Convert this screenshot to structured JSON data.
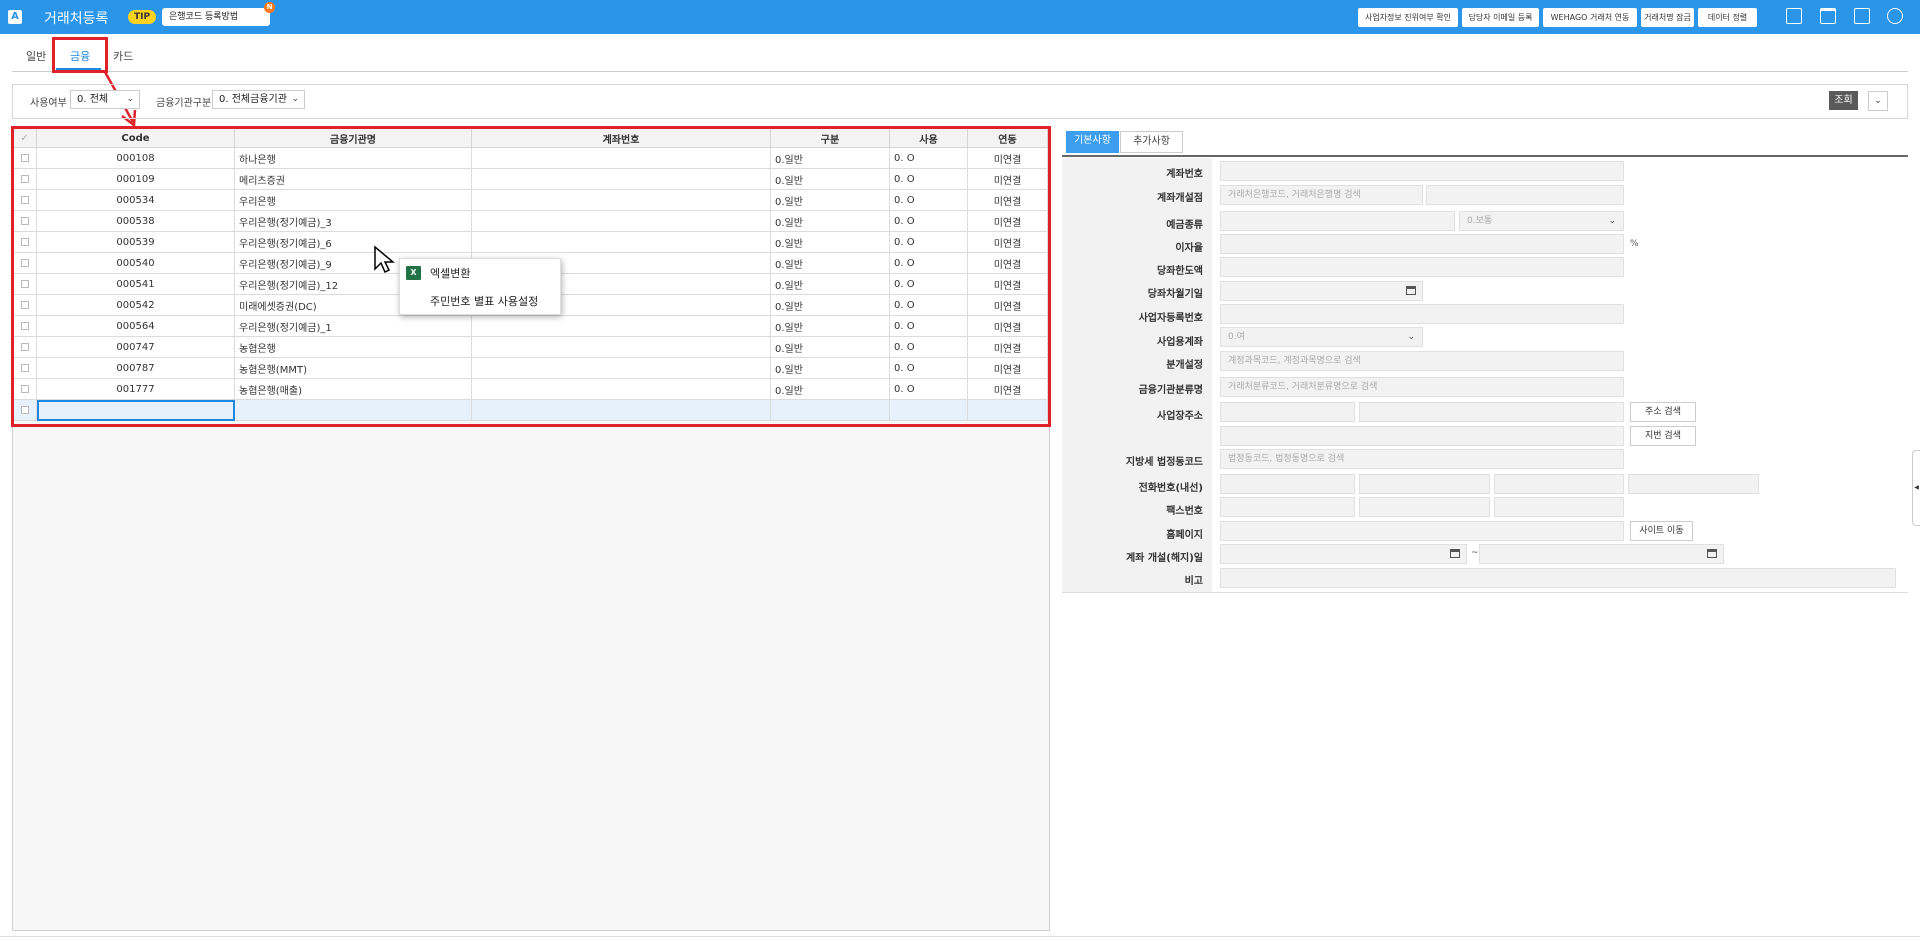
{
  "header": {
    "logo": "A",
    "title": "거래처등록",
    "tip_badge": "TIP",
    "tip_text": "은행코드 등록방법",
    "notification_badge": "N",
    "buttons": [
      "사업자정보 진위여부 확인",
      "담당자 이메일 등록",
      "WEHAGO 거래처 연동",
      "거래처명 잠금",
      "데이터 정렬"
    ],
    "icons": [
      "print-icon",
      "trash-icon",
      "form-icon",
      "settings-circle-icon"
    ],
    "color": "#2b95e9"
  },
  "tabs": [
    "일반",
    "금융",
    "카드"
  ],
  "active_tab": "금융",
  "filters": {
    "usage_label": "사용여부",
    "usage_value": "0. 전체",
    "institution_label": "금융기관구분",
    "institution_value": "0. 전체금융기관",
    "search_button": "조회"
  },
  "grid": {
    "columns": [
      "Code",
      "금융기관명",
      "계좌번호",
      "구분",
      "사용",
      "연동"
    ],
    "rows": [
      {
        "code": "000108",
        "name": "하나은행",
        "account": "",
        "type": "0.일반",
        "use": "0. O",
        "link": "미연결"
      },
      {
        "code": "000109",
        "name": "메리츠증권",
        "account": "",
        "type": "0.일반",
        "use": "0. O",
        "link": "미연결"
      },
      {
        "code": "000534",
        "name": "우리은행",
        "account": "",
        "type": "0.일반",
        "use": "0. O",
        "link": "미연결"
      },
      {
        "code": "000538",
        "name": "우리은행(정기예금)_3",
        "account": "",
        "type": "0.일반",
        "use": "0. O",
        "link": "미연결"
      },
      {
        "code": "000539",
        "name": "우리은행(정기예금)_6",
        "account": "",
        "type": "0.일반",
        "use": "0. O",
        "link": "미연결"
      },
      {
        "code": "000540",
        "name": "우리은행(정기예금)_9",
        "account": "",
        "type": "0.일반",
        "use": "0. O",
        "link": "미연결"
      },
      {
        "code": "000541",
        "name": "우리은행(정기예금)_12",
        "account": "",
        "type": "0.일반",
        "use": "0. O",
        "link": "미연결"
      },
      {
        "code": "000542",
        "name": "미래에셋증권(DC)",
        "account": "",
        "type": "0.일반",
        "use": "0. O",
        "link": "미연결"
      },
      {
        "code": "000564",
        "name": "우리은행(정기예금)_1",
        "account": "",
        "type": "0.일반",
        "use": "0. O",
        "link": "미연결"
      },
      {
        "code": "000747",
        "name": "농협은행",
        "account": "",
        "type": "0.일반",
        "use": "0. O",
        "link": "미연결"
      },
      {
        "code": "000787",
        "name": "농협은행(MMT)",
        "account": "",
        "type": "0.일반",
        "use": "0. O",
        "link": "미연결"
      },
      {
        "code": "001777",
        "name": "농협은행(매출)",
        "account": "",
        "type": "0.일반",
        "use": "0. O",
        "link": "미연결"
      }
    ]
  },
  "context_menu": {
    "items": [
      "엑셀변환",
      "주민번호 별표 사용설정"
    ]
  },
  "detail": {
    "tabs": [
      "기본사항",
      "추가사항"
    ],
    "labels": {
      "account_no": "계좌번호",
      "branch": "계좌개설점",
      "deposit_type": "예금종류",
      "interest": "이자율",
      "overdraft": "당좌한도액",
      "overdraft_due": "당좌차월기일",
      "biz_no": "사업자등록번호",
      "biz_account": "사업용계좌",
      "category": "분개설정",
      "inst_class": "금융기관분류명",
      "address": "사업장주소",
      "local_tax": "지방세 법정동코드",
      "phone": "전화번호(내선)",
      "fax": "팩스번호",
      "homepage": "홈페이지",
      "open_date": "계좌 개설(해지)일",
      "memo": "비고"
    },
    "placeholders": {
      "branch": "거래처은행코드, 거래처은행명 검색",
      "category": "계정과목코드, 계정과목명으로 검색",
      "inst_class": "거래처분류코드, 거래처분류명으로 검색",
      "local_tax": "법정동코드, 법정동명으로 검색"
    },
    "values": {
      "deposit_type": "0.보통",
      "biz_account": "0.여"
    },
    "units": {
      "interest": "%",
      "date_sep": "~"
    },
    "buttons": {
      "addr_search": "주소 검색",
      "lot_search": "지번 검색",
      "site_go": "사이트 이동"
    }
  }
}
